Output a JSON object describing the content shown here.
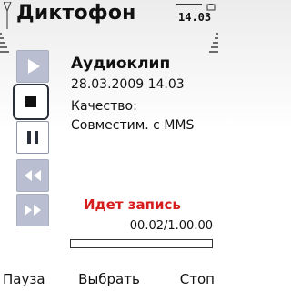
{
  "app": {
    "title": "Диктофон"
  },
  "status": {
    "clock": "14.03",
    "signal_bars": 5,
    "battery_bars": 5
  },
  "controls": [
    {
      "name": "play",
      "icon": "play-icon",
      "state": "disabled"
    },
    {
      "name": "stop",
      "icon": "stop-icon",
      "state": "active"
    },
    {
      "name": "pause",
      "icon": "pause-icon",
      "state": "normal"
    },
    {
      "name": "rewind",
      "icon": "rewind-icon",
      "state": "disabled"
    },
    {
      "name": "forward",
      "icon": "fast-forward-icon",
      "state": "disabled"
    }
  ],
  "clip": {
    "title": "Аудиоклип",
    "date": "28.03.2009 14.03",
    "quality_label": "Качество:",
    "quality_value": "Совместим. с MMS"
  },
  "recording": {
    "status": "Идет запись",
    "time": "00.02/1.00.00",
    "progress": 0.0
  },
  "softkeys": {
    "left": "Пауза",
    "middle": "Выбрать",
    "right": "Стоп"
  },
  "colors": {
    "recording": "#d61c1c",
    "disabled_button": "#b9bfd0",
    "text": "#111111"
  }
}
